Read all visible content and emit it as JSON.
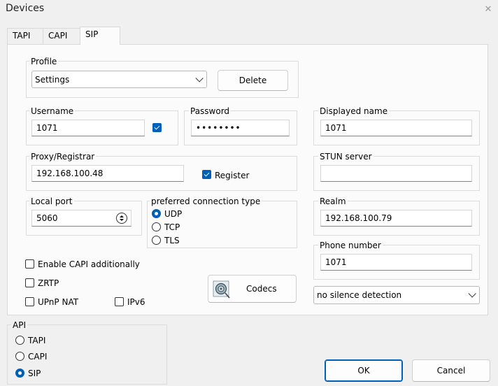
{
  "window": {
    "title": "Devices",
    "close_glyph": "✕"
  },
  "tabs": [
    {
      "label": "TAPI",
      "active": false
    },
    {
      "label": "CAPI",
      "active": false
    },
    {
      "label": "SIP",
      "active": true
    }
  ],
  "profile": {
    "label": "Profile",
    "value": "Settings",
    "delete_label": "Delete"
  },
  "username": {
    "label": "Username",
    "value": "1071",
    "checked": true
  },
  "password": {
    "label": "Password",
    "value": "••••••••"
  },
  "displayed_name": {
    "label": "Displayed name",
    "value": "1071"
  },
  "proxy": {
    "label": "Proxy/Registrar",
    "value": "192.168.100.48",
    "register_label": "Register",
    "register_checked": true
  },
  "stun": {
    "label": "STUN server",
    "value": ""
  },
  "local_port": {
    "label": "Local port",
    "value": "5060"
  },
  "connection": {
    "label": "preferred connection type",
    "options": [
      "UDP",
      "TCP",
      "TLS"
    ],
    "selected": "UDP"
  },
  "realm": {
    "label": "Realm",
    "value": "192.168.100.79"
  },
  "phone_number": {
    "label": "Phone number",
    "value": "1071"
  },
  "options": {
    "enable_capi": "Enable CAPI additionally",
    "zrtp": "ZRTP",
    "upnp": "UPnP NAT",
    "ipv6": "IPv6"
  },
  "codecs": {
    "label": "Codecs",
    "icon": "speaker-icon"
  },
  "silence": {
    "value": "no silence detection"
  },
  "api": {
    "label": "API",
    "options": [
      "TAPI",
      "CAPI",
      "SIP"
    ],
    "selected": "SIP"
  },
  "footer": {
    "ok_label": "OK",
    "cancel_label": "Cancel"
  },
  "colors": {
    "accent": "#005fb8",
    "panel": "#fbfbfb",
    "window": "#f0f0f0"
  }
}
